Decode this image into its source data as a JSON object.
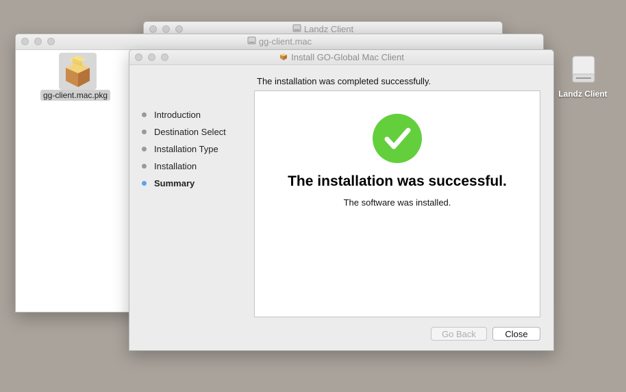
{
  "windows": {
    "back": {
      "title": "Landz Client"
    },
    "folder": {
      "title": "gg-client.mac",
      "file": {
        "name": "gg-client.mac.pkg",
        "icon": "package-icon"
      }
    },
    "installer": {
      "title": "Install GO-Global Mac Client",
      "header_message": "The installation was completed successfully.",
      "steps": [
        {
          "label": "Introduction",
          "active": false
        },
        {
          "label": "Destination Select",
          "active": false
        },
        {
          "label": "Installation Type",
          "active": false
        },
        {
          "label": "Installation",
          "active": false
        },
        {
          "label": "Summary",
          "active": true
        }
      ],
      "success_title": "The installation was successful.",
      "success_subtitle": "The software was installed.",
      "buttons": {
        "go_back": "Go Back",
        "close": "Close"
      },
      "colors": {
        "success": "#63cf3d",
        "active_step": "#5aa3f0"
      }
    }
  },
  "desktop": {
    "drive": {
      "label": "Landz Client",
      "icon": "disk-drive-icon"
    }
  }
}
